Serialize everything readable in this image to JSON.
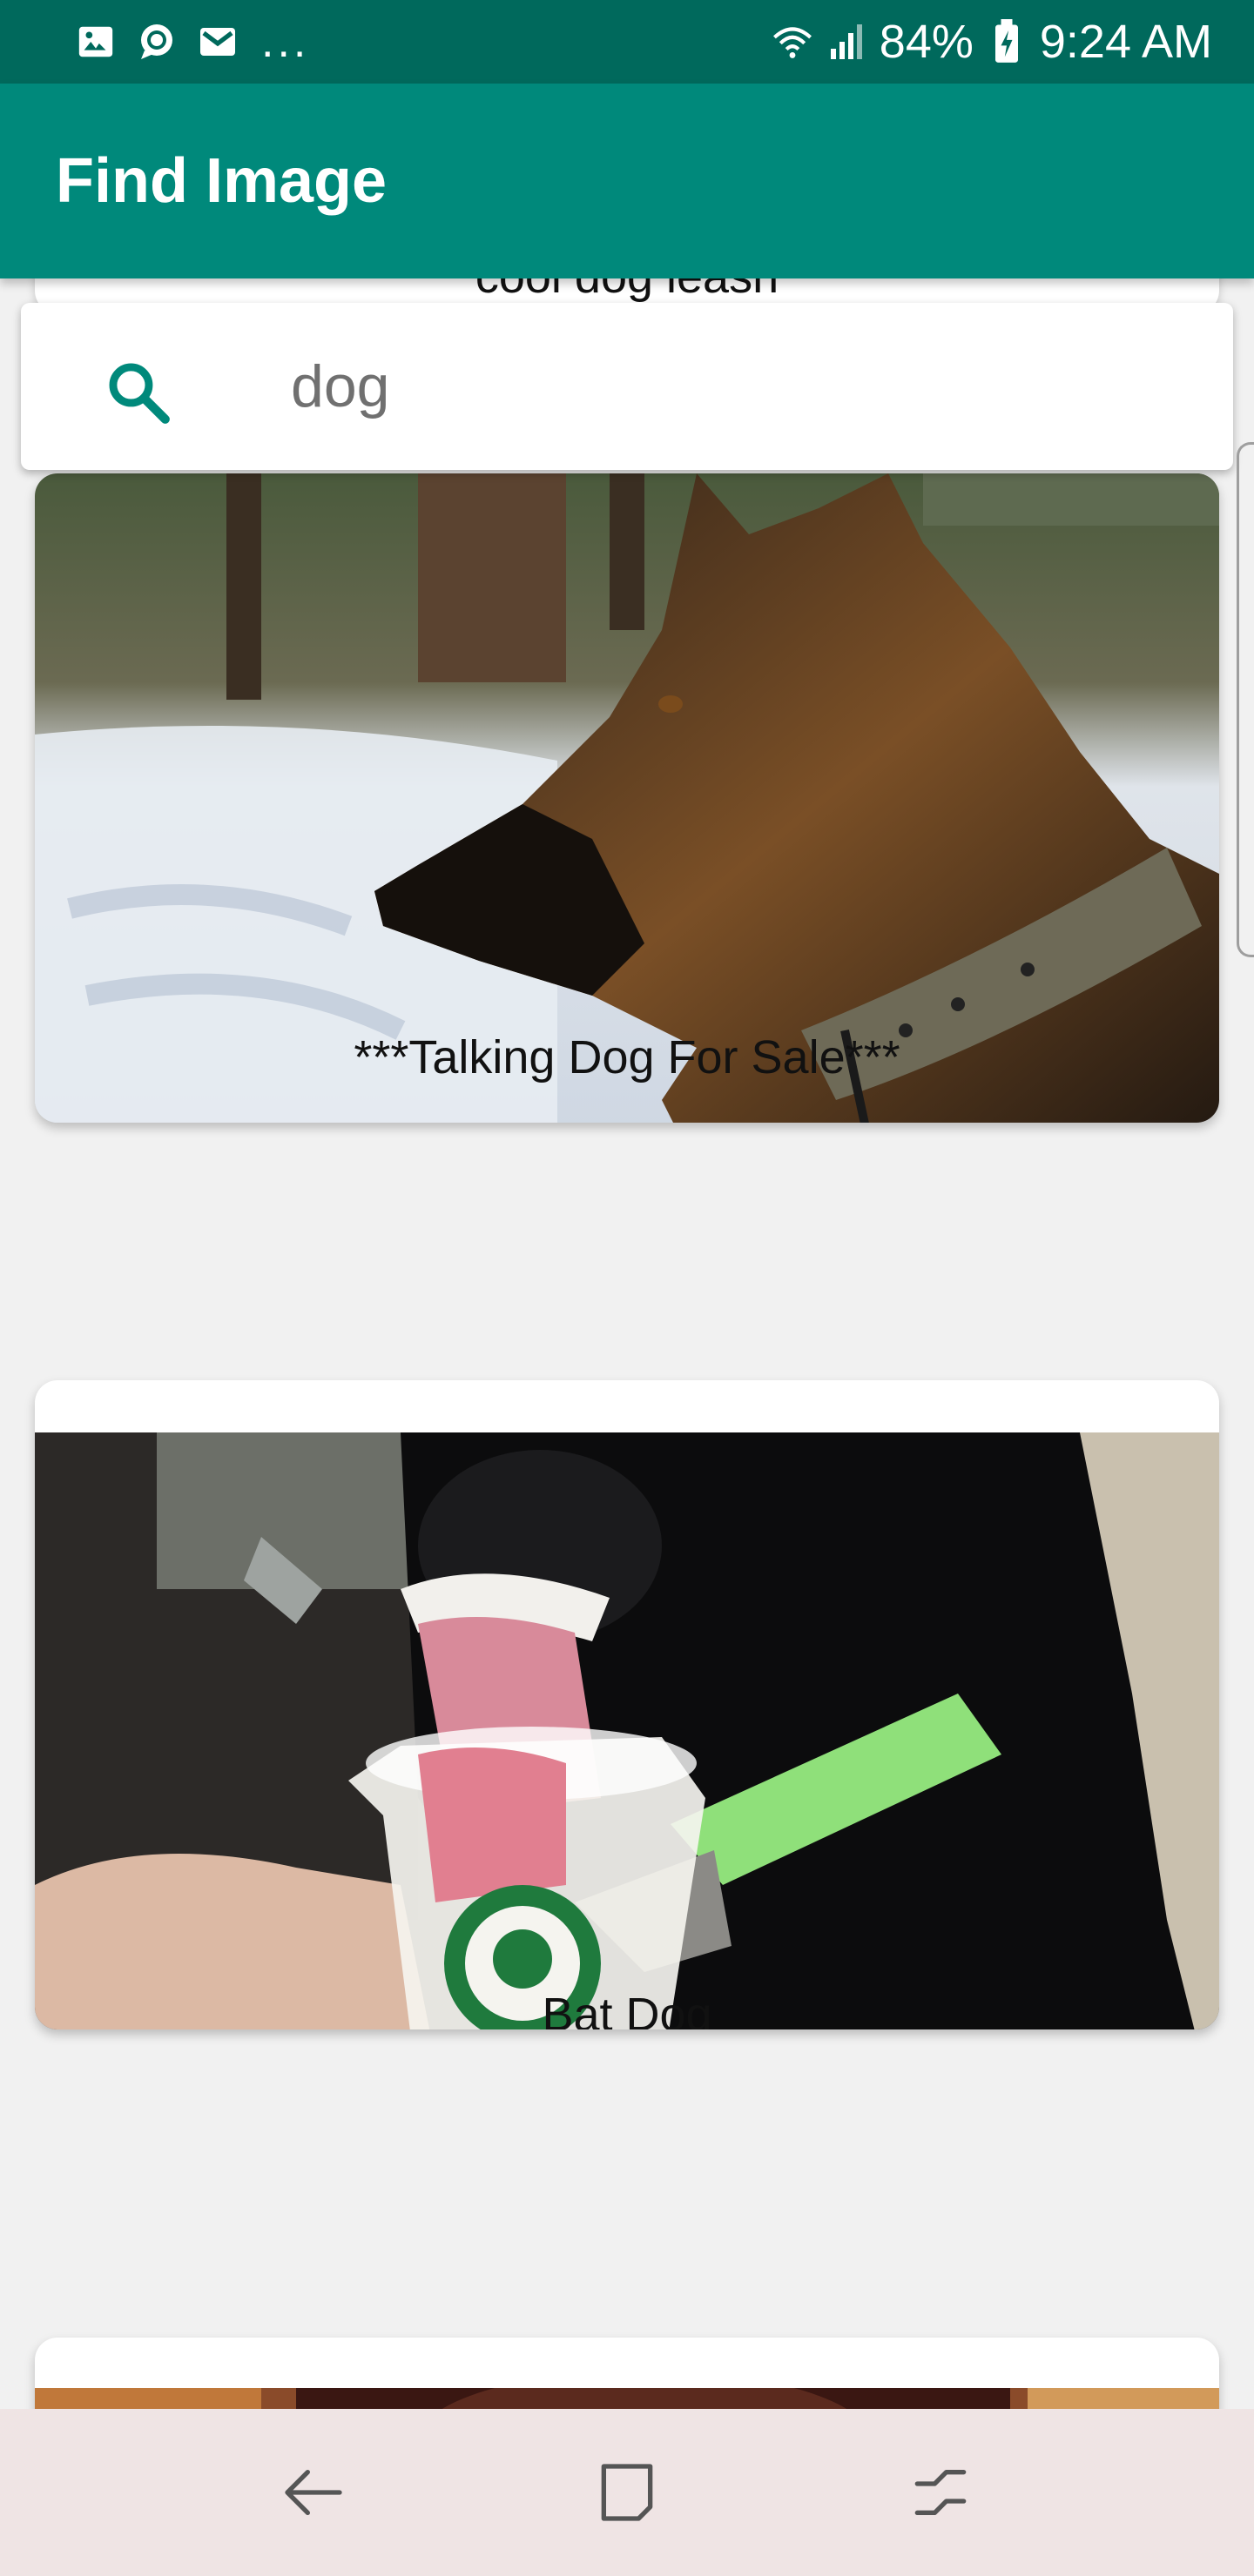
{
  "status_bar": {
    "icons": [
      "image-icon",
      "chat-bubble-icon",
      "gmail-icon"
    ],
    "more": "...",
    "battery": "84%",
    "time": "9:24 AM",
    "right_icons": [
      "wifi-icon",
      "signal-icon",
      "battery-icon"
    ]
  },
  "app_bar": {
    "title": "Find Image"
  },
  "search": {
    "icon": "search-icon",
    "value": "dog",
    "accent": "#00897b"
  },
  "results": {
    "partial_title": "cool dog leash",
    "items": [
      {
        "label": "***Talking Dog For Sale***"
      },
      {
        "label": "Bat Dog"
      }
    ]
  },
  "nav_bar": {
    "buttons": [
      "back-icon",
      "home-icon",
      "recents-icon"
    ]
  },
  "colors": {
    "status_bar": "#00695c",
    "app_bar": "#00897b",
    "background": "#f1f1f1",
    "nav_bar": "#efe4e4"
  }
}
